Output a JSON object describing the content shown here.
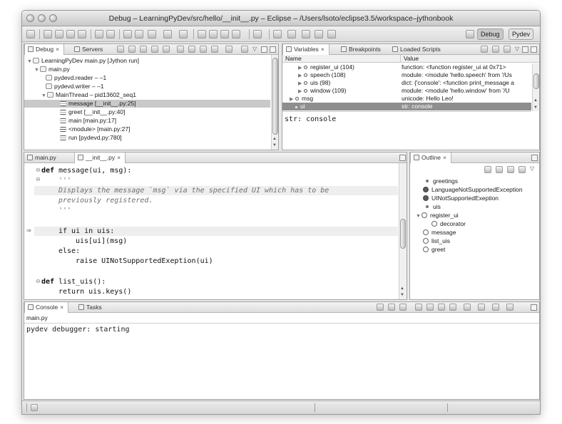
{
  "window": {
    "title": "Debug – LearningPyDev/src/hello/__init__.py – Eclipse – /Users/lsoto/eclipse3.5/workspace–jythonbook"
  },
  "perspectives": {
    "debug": "Debug",
    "pydev": "Pydev"
  },
  "debug_panel": {
    "tabs": {
      "debug": "Debug",
      "servers": "Servers"
    },
    "tree": [
      "LearningPyDev main.py [Jython run]",
      "main.py",
      "pydevd.reader – –1",
      "pydevd.writer – –1",
      "MainThread – pid13602_seq1",
      "message [__init__.py:25]",
      "greet [__init__.py:40]",
      "main [main.py:17]",
      "<module> [main.py:27]",
      "run [pydevd.py:780]"
    ]
  },
  "variables_panel": {
    "tabs": {
      "variables": "Variables",
      "breakpoints": "Breakpoints",
      "scripts": "Loaded Scripts"
    },
    "headers": {
      "name": "Name",
      "value": "Value"
    },
    "rows": [
      {
        "name": "register_ui (104)",
        "value": "function: <function register_ui at 0x71>"
      },
      {
        "name": "speech (108)",
        "value": "module: <module 'hello.speech' from '/Us"
      },
      {
        "name": "uis (98)",
        "value": "dict: {'console': <function print_message a"
      },
      {
        "name": "window (109)",
        "value": "module: <module 'hello.window' from '/U"
      },
      {
        "name": "msg",
        "value": "unicode: Hello Leo!"
      },
      {
        "name": "ui",
        "value": "str: console"
      }
    ],
    "detail": "str: console"
  },
  "editor": {
    "tabs": {
      "main": "main.py",
      "init": "__init__.py"
    },
    "lines": [
      {
        "kw": "def ",
        "text": "message(ui, msg):",
        "indent": ""
      },
      {
        "kw": "",
        "text": "'''",
        "indent": "    "
      },
      {
        "kw": "",
        "text": "Displays the message `msg` via the specified UI which has to be",
        "indent": "    "
      },
      {
        "kw": "",
        "text": "previously registered.",
        "indent": "    "
      },
      {
        "kw": "",
        "text": "'''",
        "indent": "    "
      },
      {
        "kw": "",
        "text": "if ui in uis:",
        "indent": "    "
      },
      {
        "kw": "",
        "text": "uis[ui](msg)",
        "indent": "        "
      },
      {
        "kw": "",
        "text": "else:",
        "indent": "    "
      },
      {
        "kw": "",
        "text": "raise UINotSupportedExeption(ui)",
        "indent": "        "
      },
      {
        "kw": "",
        "text": "",
        "indent": ""
      },
      {
        "kw": "def ",
        "text": "list_uis():",
        "indent": ""
      },
      {
        "kw": "",
        "text": "return uis.keys()",
        "indent": "    "
      }
    ]
  },
  "outline_panel": {
    "tab": "Outline",
    "items": [
      {
        "label": "greetings",
        "kind": "var"
      },
      {
        "label": "LanguageNotSupportedException",
        "kind": "class"
      },
      {
        "label": "UINotSupportedExeption",
        "kind": "class"
      },
      {
        "label": "uis",
        "kind": "var"
      },
      {
        "label": "register_ui",
        "kind": "func"
      },
      {
        "label": "decorator",
        "kind": "func"
      },
      {
        "label": "message",
        "kind": "func"
      },
      {
        "label": "list_uis",
        "kind": "func"
      },
      {
        "label": "greet",
        "kind": "func"
      }
    ]
  },
  "console_panel": {
    "tabs": {
      "console": "Console",
      "tasks": "Tasks"
    },
    "source": "main.py",
    "output": "pydev debugger: starting"
  }
}
